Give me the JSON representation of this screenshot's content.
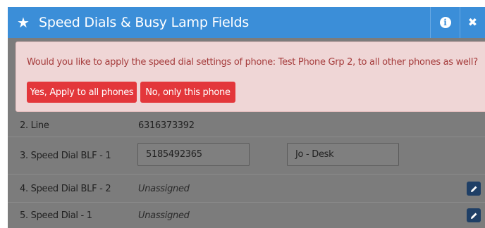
{
  "header": {
    "title": "Speed Dials & Busy Lamp Fields",
    "info_icon": "info-icon",
    "close_icon": "close-icon"
  },
  "alert": {
    "message": "Would you like to apply the speed dial settings of phone: Test Phone Grp 2, to all other phones as well?",
    "yes_label": "Yes, Apply to all phones",
    "no_label": "No, only this phone"
  },
  "rows": [
    {
      "label": "2. Line",
      "value": "6316373392"
    },
    {
      "label": "3. Speed Dial BLF - 1",
      "number": "5185492365",
      "name": "Jo - Desk"
    },
    {
      "label": "4. Speed Dial BLF - 2",
      "value": "Unassigned"
    },
    {
      "label": "5. Speed Dial - 1",
      "value": "Unassigned"
    }
  ],
  "colors": {
    "header": "#3b8ed8",
    "alert_bg": "#efd6d6",
    "alert_text": "#a53b3b",
    "button": "#e3373b",
    "overlay": "#7c7c7c",
    "edit_button": "#1f3f66"
  }
}
